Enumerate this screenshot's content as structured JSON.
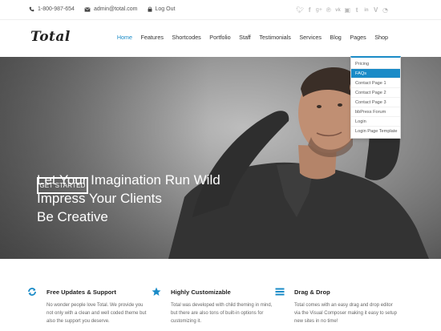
{
  "topbar": {
    "phone": "1-800-987-654",
    "email": "admin@total.com",
    "logout": "Log Out",
    "social_icons": [
      "twitter-icon",
      "facebook-icon",
      "google-plus-icon",
      "pinterest-icon",
      "vk-icon",
      "instagram-icon",
      "tumblr-icon",
      "linkedin-icon",
      "vine-icon",
      "rss-icon"
    ]
  },
  "header": {
    "logo": "Total",
    "nav": [
      "Home",
      "Features",
      "Shortcodes",
      "Portfolio",
      "Staff",
      "Testimonials",
      "Services",
      "Blog",
      "Pages",
      "Shop"
    ],
    "active_nav": "Home"
  },
  "dropdown": {
    "items": [
      "Pricing",
      "FAQs",
      "Contact Page 1",
      "Contact Page 2",
      "Contact Page 3",
      "bbPress Forum",
      "Login",
      "Login Page Template"
    ],
    "selected": "FAQs"
  },
  "hero": {
    "line1": "Let Your Imagination Run Wild",
    "line2": "Impress Your Clients",
    "line3": "Be Creative",
    "cta": "GET STARTED"
  },
  "features": [
    {
      "icon": "refresh-icon",
      "title": "Free Updates & Support",
      "text": "No wonder people love Total. We provide you not only with a clean and well coded theme but also the support you deserve."
    },
    {
      "icon": "star-icon",
      "title": "Highly Customizable",
      "text": "Total was developed with child theming in mind, but there are also tons of built-in options for customizing it."
    },
    {
      "icon": "bars-icon",
      "title": "Drag & Drop",
      "text": "Total comes with an easy drag and drop editor via the Visual Composer making it easy to setup new sites in no time!"
    }
  ],
  "colors": {
    "accent": "#1a8bc7",
    "hero_overlay": "#555555"
  }
}
